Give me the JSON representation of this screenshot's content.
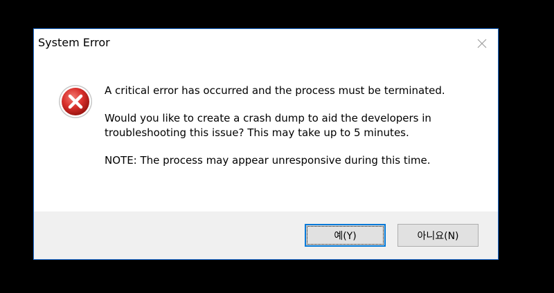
{
  "dialog": {
    "title": "System Error",
    "close_icon": "close-icon",
    "error_icon": "error-icon",
    "messages": [
      "A critical error has occurred and the process must be terminated.",
      "Would you like to create a crash dump to aid the developers in troubleshooting this issue? This may take up to 5 minutes.",
      "NOTE: The process may appear unresponsive during this time."
    ],
    "buttons": {
      "yes_label": "예(Y)",
      "no_label": "아니요(N)"
    }
  },
  "colors": {
    "accent": "#0078d7",
    "error_red": "#d9302c",
    "footer_bg": "#f0f0f0"
  }
}
